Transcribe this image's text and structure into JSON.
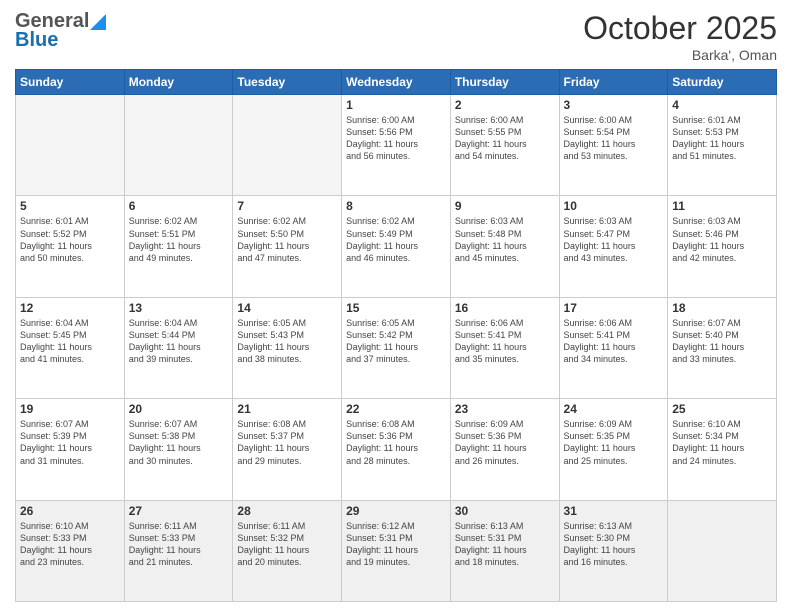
{
  "header": {
    "logo_general": "General",
    "logo_blue": "Blue",
    "month": "October 2025",
    "location": "Barka', Oman"
  },
  "days_of_week": [
    "Sunday",
    "Monday",
    "Tuesday",
    "Wednesday",
    "Thursday",
    "Friday",
    "Saturday"
  ],
  "weeks": [
    [
      {
        "day": "",
        "info": ""
      },
      {
        "day": "",
        "info": ""
      },
      {
        "day": "",
        "info": ""
      },
      {
        "day": "1",
        "info": "Sunrise: 6:00 AM\nSunset: 5:56 PM\nDaylight: 11 hours\nand 56 minutes."
      },
      {
        "day": "2",
        "info": "Sunrise: 6:00 AM\nSunset: 5:55 PM\nDaylight: 11 hours\nand 54 minutes."
      },
      {
        "day": "3",
        "info": "Sunrise: 6:00 AM\nSunset: 5:54 PM\nDaylight: 11 hours\nand 53 minutes."
      },
      {
        "day": "4",
        "info": "Sunrise: 6:01 AM\nSunset: 5:53 PM\nDaylight: 11 hours\nand 51 minutes."
      }
    ],
    [
      {
        "day": "5",
        "info": "Sunrise: 6:01 AM\nSunset: 5:52 PM\nDaylight: 11 hours\nand 50 minutes."
      },
      {
        "day": "6",
        "info": "Sunrise: 6:02 AM\nSunset: 5:51 PM\nDaylight: 11 hours\nand 49 minutes."
      },
      {
        "day": "7",
        "info": "Sunrise: 6:02 AM\nSunset: 5:50 PM\nDaylight: 11 hours\nand 47 minutes."
      },
      {
        "day": "8",
        "info": "Sunrise: 6:02 AM\nSunset: 5:49 PM\nDaylight: 11 hours\nand 46 minutes."
      },
      {
        "day": "9",
        "info": "Sunrise: 6:03 AM\nSunset: 5:48 PM\nDaylight: 11 hours\nand 45 minutes."
      },
      {
        "day": "10",
        "info": "Sunrise: 6:03 AM\nSunset: 5:47 PM\nDaylight: 11 hours\nand 43 minutes."
      },
      {
        "day": "11",
        "info": "Sunrise: 6:03 AM\nSunset: 5:46 PM\nDaylight: 11 hours\nand 42 minutes."
      }
    ],
    [
      {
        "day": "12",
        "info": "Sunrise: 6:04 AM\nSunset: 5:45 PM\nDaylight: 11 hours\nand 41 minutes."
      },
      {
        "day": "13",
        "info": "Sunrise: 6:04 AM\nSunset: 5:44 PM\nDaylight: 11 hours\nand 39 minutes."
      },
      {
        "day": "14",
        "info": "Sunrise: 6:05 AM\nSunset: 5:43 PM\nDaylight: 11 hours\nand 38 minutes."
      },
      {
        "day": "15",
        "info": "Sunrise: 6:05 AM\nSunset: 5:42 PM\nDaylight: 11 hours\nand 37 minutes."
      },
      {
        "day": "16",
        "info": "Sunrise: 6:06 AM\nSunset: 5:41 PM\nDaylight: 11 hours\nand 35 minutes."
      },
      {
        "day": "17",
        "info": "Sunrise: 6:06 AM\nSunset: 5:41 PM\nDaylight: 11 hours\nand 34 minutes."
      },
      {
        "day": "18",
        "info": "Sunrise: 6:07 AM\nSunset: 5:40 PM\nDaylight: 11 hours\nand 33 minutes."
      }
    ],
    [
      {
        "day": "19",
        "info": "Sunrise: 6:07 AM\nSunset: 5:39 PM\nDaylight: 11 hours\nand 31 minutes."
      },
      {
        "day": "20",
        "info": "Sunrise: 6:07 AM\nSunset: 5:38 PM\nDaylight: 11 hours\nand 30 minutes."
      },
      {
        "day": "21",
        "info": "Sunrise: 6:08 AM\nSunset: 5:37 PM\nDaylight: 11 hours\nand 29 minutes."
      },
      {
        "day": "22",
        "info": "Sunrise: 6:08 AM\nSunset: 5:36 PM\nDaylight: 11 hours\nand 28 minutes."
      },
      {
        "day": "23",
        "info": "Sunrise: 6:09 AM\nSunset: 5:36 PM\nDaylight: 11 hours\nand 26 minutes."
      },
      {
        "day": "24",
        "info": "Sunrise: 6:09 AM\nSunset: 5:35 PM\nDaylight: 11 hours\nand 25 minutes."
      },
      {
        "day": "25",
        "info": "Sunrise: 6:10 AM\nSunset: 5:34 PM\nDaylight: 11 hours\nand 24 minutes."
      }
    ],
    [
      {
        "day": "26",
        "info": "Sunrise: 6:10 AM\nSunset: 5:33 PM\nDaylight: 11 hours\nand 23 minutes."
      },
      {
        "day": "27",
        "info": "Sunrise: 6:11 AM\nSunset: 5:33 PM\nDaylight: 11 hours\nand 21 minutes."
      },
      {
        "day": "28",
        "info": "Sunrise: 6:11 AM\nSunset: 5:32 PM\nDaylight: 11 hours\nand 20 minutes."
      },
      {
        "day": "29",
        "info": "Sunrise: 6:12 AM\nSunset: 5:31 PM\nDaylight: 11 hours\nand 19 minutes."
      },
      {
        "day": "30",
        "info": "Sunrise: 6:13 AM\nSunset: 5:31 PM\nDaylight: 11 hours\nand 18 minutes."
      },
      {
        "day": "31",
        "info": "Sunrise: 6:13 AM\nSunset: 5:30 PM\nDaylight: 11 hours\nand 16 minutes."
      },
      {
        "day": "",
        "info": ""
      }
    ]
  ]
}
